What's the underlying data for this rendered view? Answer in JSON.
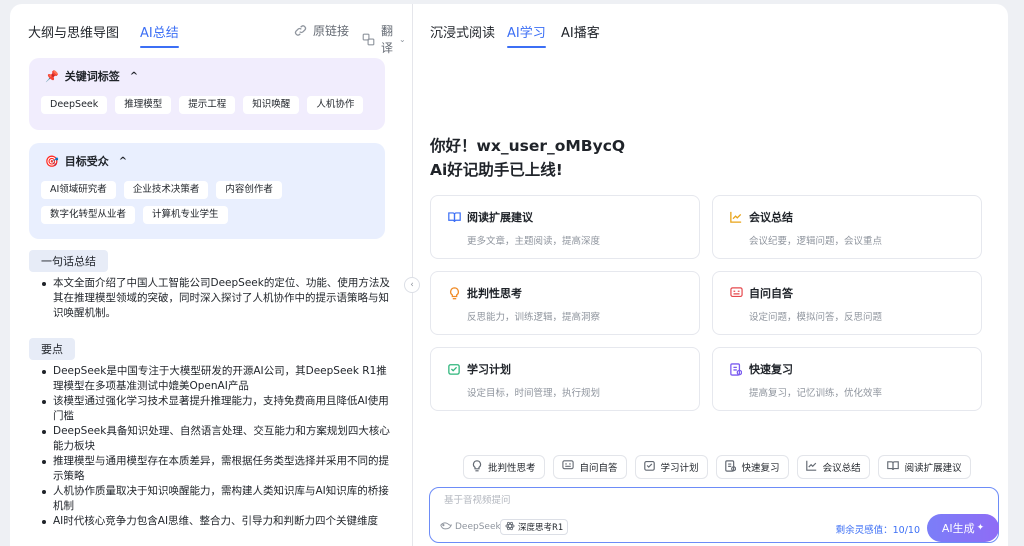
{
  "left": {
    "tabs": [
      {
        "label": "大纲与思维导图",
        "active": false
      },
      {
        "label": "AI总结",
        "active": true
      }
    ],
    "actions": {
      "original_link": "原链接",
      "translate": "翻译"
    },
    "keywords": {
      "emoji": "📌",
      "title": "关键词标签",
      "chevron": "^",
      "items": [
        "DeepSeek",
        "推理模型",
        "提示工程",
        "知识唤醒",
        "人机协作"
      ]
    },
    "audience": {
      "emoji": "🎯",
      "title": "目标受众",
      "chevron": "^",
      "items": [
        "AI领域研究者",
        "企业技术决策者",
        "内容创作者",
        "数字化转型从业者",
        "计算机专业学生"
      ]
    },
    "one_line": {
      "title": "一句话总结",
      "bullets": [
        "本文全面介绍了中国人工智能公司DeepSeek的定位、功能、使用方法及其在推理模型领域的突破，同时深入探讨了人机协作中的提示语策略与知识唤醒机制。"
      ]
    },
    "key_points": {
      "title": "要点",
      "bullets": [
        "DeepSeek是中国专注于大模型研发的开源AI公司，其DeepSeek R1推理模型在多项基准测试中媲美OpenAI产品",
        "该模型通过强化学习技术显著提升推理能力，支持免费商用且降低AI使用门槛",
        "DeepSeek具备知识处理、自然语言处理、交互能力和方案规划四大核心能力板块",
        "推理模型与通用模型存在本质差异，需根据任务类型选择并采用不同的提示策略",
        "人机协作质量取决于知识唤醒能力，需构建人类知识库与AI知识库的桥接机制",
        "AI时代核心竞争力包含AI思维、整合力、引导力和判断力四个关键维度"
      ]
    }
  },
  "right": {
    "tabs": [
      {
        "label": "沉浸式阅读",
        "active": false
      },
      {
        "label": "AI学习",
        "active": true
      },
      {
        "label": "AI播客",
        "active": false
      }
    ],
    "greeting_line1": "你好！wx_user_oMBycQ",
    "greeting_line2": "Ai好记助手已上线!",
    "features": [
      {
        "title": "阅读扩展建议",
        "desc": "更多文章，主题阅读，提高深度",
        "icon": "book-icon",
        "color": "#3c6ff5"
      },
      {
        "title": "会议总结",
        "desc": "会议纪要，逻辑问题，会议重点",
        "icon": "chart-icon",
        "color": "#e8a317"
      },
      {
        "title": "批判性思考",
        "desc": "反思能力，训练逻辑，提高洞察",
        "icon": "bulb-icon",
        "color": "#f08a24"
      },
      {
        "title": "自问自答",
        "desc": "设定问题，模拟问答，反思问题",
        "icon": "qa-icon",
        "color": "#e5484d"
      },
      {
        "title": "学习计划",
        "desc": "设定目标，时间管理，执行规划",
        "icon": "calendar-icon",
        "color": "#2fb67c"
      },
      {
        "title": "快速复习",
        "desc": "提高复习，记忆训练，优化效率",
        "icon": "review-icon",
        "color": "#7b5cf0"
      }
    ],
    "quick_buttons": [
      {
        "label": "批判性思考",
        "icon": "bulb-icon"
      },
      {
        "label": "自问自答",
        "icon": "qa-icon"
      },
      {
        "label": "学习计划",
        "icon": "calendar-icon"
      },
      {
        "label": "快速复习",
        "icon": "review-icon"
      },
      {
        "label": "会议总结",
        "icon": "chart-icon"
      },
      {
        "label": "阅读扩展建议",
        "icon": "book-icon"
      }
    ],
    "input": {
      "placeholder": "基于音视频提问",
      "value": "",
      "model": "DeepSeek",
      "deep_think": "深度思考R1",
      "quota": "剩余灵感值：10/10",
      "generate": "AI生成"
    }
  }
}
